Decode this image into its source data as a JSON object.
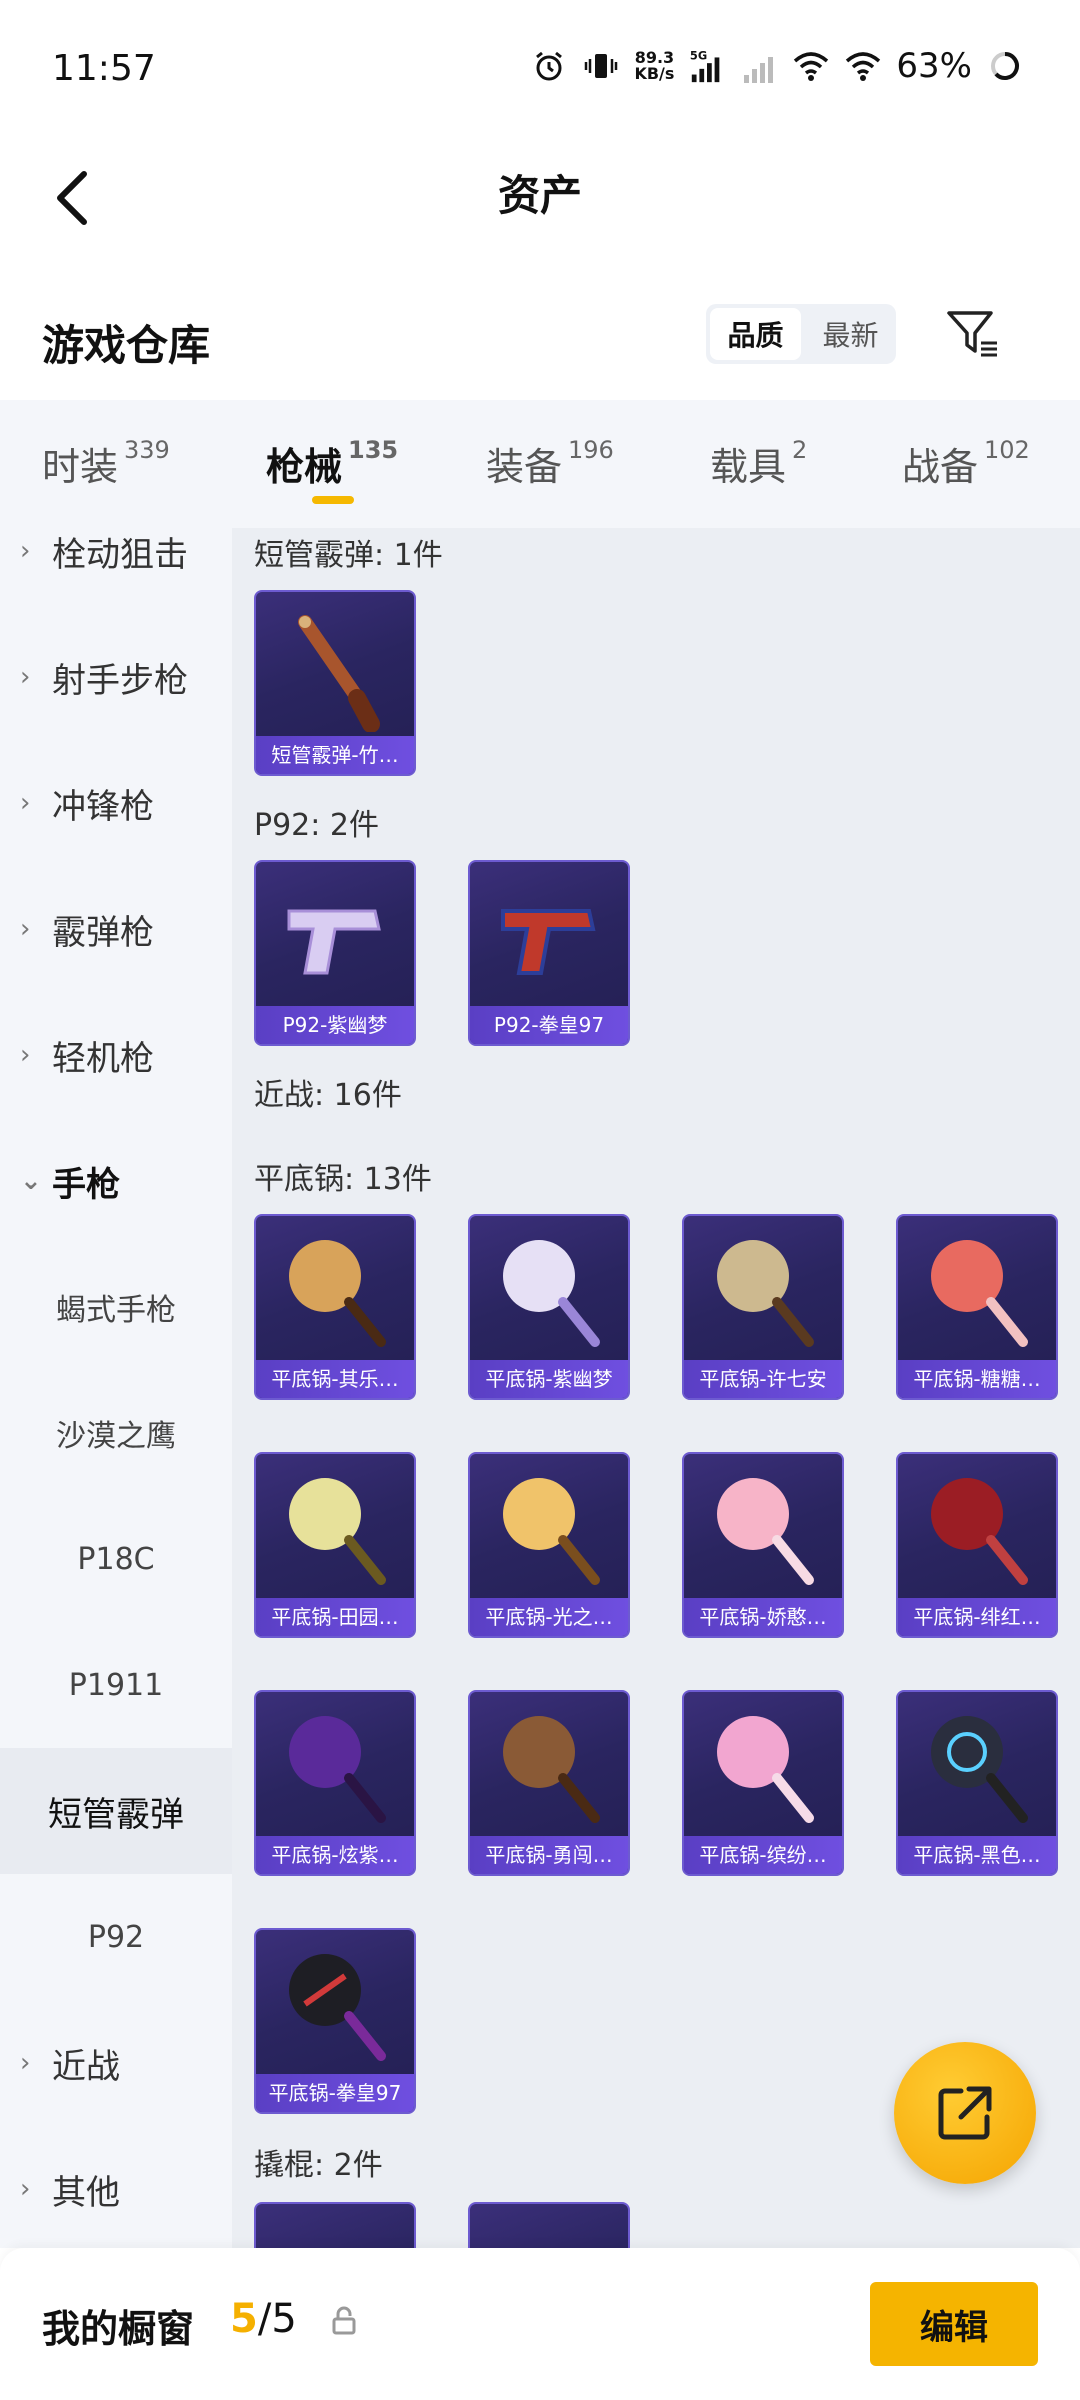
{
  "status_bar": {
    "time": "11:57",
    "net_speed_value": "89.3",
    "net_speed_unit": "KB/s",
    "network_type": "5G",
    "battery": "63%"
  },
  "header": {
    "title": "资产",
    "back_icon": "chevron-left-icon"
  },
  "section": {
    "title": "游戏仓库",
    "sort_options": [
      "品质",
      "最新"
    ],
    "active_sort": "品质",
    "filter_icon": "filter-icon"
  },
  "tabs": [
    {
      "label": "时装",
      "count": "339"
    },
    {
      "label": "枪械",
      "count": "135"
    },
    {
      "label": "装备",
      "count": "196"
    },
    {
      "label": "载具",
      "count": "2"
    },
    {
      "label": "战备",
      "count": "102"
    }
  ],
  "active_tab": "枪械",
  "sidebar": {
    "items": [
      {
        "label": "栓动狙击"
      },
      {
        "label": "射手步枪"
      },
      {
        "label": "冲锋枪"
      },
      {
        "label": "霰弹枪"
      },
      {
        "label": "轻机枪"
      },
      {
        "label": "手枪"
      },
      {
        "label": "蝎式手枪"
      },
      {
        "label": "沙漠之鹰"
      },
      {
        "label": "P18C"
      },
      {
        "label": "P1911"
      },
      {
        "label": "短管霰弹"
      },
      {
        "label": "P92"
      },
      {
        "label": "近战"
      },
      {
        "label": "其他"
      }
    ],
    "selected": "短管霰弹"
  },
  "content": {
    "groups": [
      {
        "label": "短管霰弹: 1件",
        "items": [
          "短管霰弹-竹…"
        ]
      },
      {
        "label": "P92: 2件",
        "items": [
          "P92-紫幽梦",
          "P92-拳皇97"
        ]
      },
      {
        "label": "近战: 16件"
      },
      {
        "label": "平底锅: 13件",
        "items": [
          "平底锅-其乐…",
          "平底锅-紫幽梦",
          "平底锅-许七安",
          "平底锅-糖糖…",
          "平底锅-田园…",
          "平底锅-光之…",
          "平底锅-娇憨…",
          "平底锅-绯红…",
          "平底锅-炫紫…",
          "平底锅-勇闯…",
          "平底锅-缤纷…",
          "平底锅-黑色…",
          "平底锅-拳皇97"
        ]
      },
      {
        "label": "撬棍: 2件"
      }
    ]
  },
  "fab": {
    "icon": "share-icon"
  },
  "bottom_bar": {
    "label": "我的橱窗",
    "current": "5",
    "total": "/5",
    "edit_label": "编辑"
  },
  "colors": {
    "accent": "#f5b400",
    "card_bg": "#2a2560",
    "card_label": "#6f4fe0",
    "content_bg": "#ebeef3",
    "sidebar_bg": "#f4f6fa"
  }
}
